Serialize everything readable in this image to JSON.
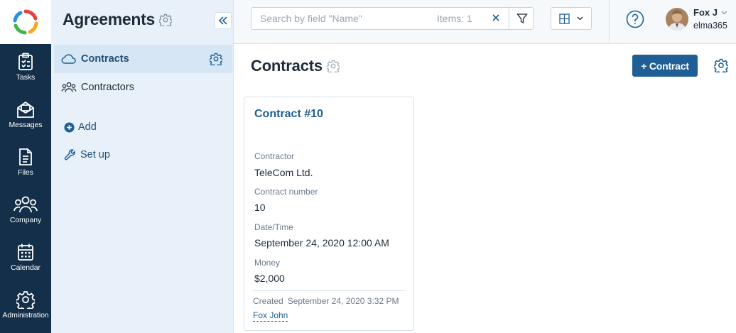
{
  "rail": {
    "logo_icon": "elma-logo-icon",
    "items": [
      {
        "label": "Tasks",
        "icon": "clipboard-check-icon"
      },
      {
        "label": "Messages",
        "icon": "envelope-icon"
      },
      {
        "label": "Files",
        "icon": "file-icon"
      },
      {
        "label": "Company",
        "icon": "people-icon"
      },
      {
        "label": "Calendar",
        "icon": "calendar-icon"
      },
      {
        "label": "Administration",
        "icon": "gear-icon"
      }
    ]
  },
  "sidebar": {
    "title": "Agreements",
    "items": [
      {
        "label": "Contracts",
        "icon": "cloud-icon",
        "active": true
      },
      {
        "label": "Contractors",
        "icon": "people-icon",
        "active": false
      }
    ],
    "add_label": "Add",
    "setup_label": "Set up"
  },
  "topbar": {
    "search_placeholder": "Search by field \"Name\"",
    "items_count": "Items: 1",
    "user_name": "Fox J",
    "user_company": "elma365"
  },
  "main": {
    "title": "Contracts",
    "add_button": "+ Contract"
  },
  "card": {
    "title": "Contract #10",
    "fields": [
      {
        "label": "Contractor",
        "value": "TeleCom Ltd."
      },
      {
        "label": "Contract number",
        "value": "10"
      },
      {
        "label": "Date/Time",
        "value": "September 24, 2020 12:00 AM"
      },
      {
        "label": "Money",
        "value": "$2,000"
      }
    ],
    "created_label": "Created",
    "created_value": "September 24, 2020 3:32 PM",
    "author": "Fox John"
  },
  "colors": {
    "rail": "#132f4a",
    "sidebar": "#e8f1f9",
    "accent": "#1f5f95"
  }
}
